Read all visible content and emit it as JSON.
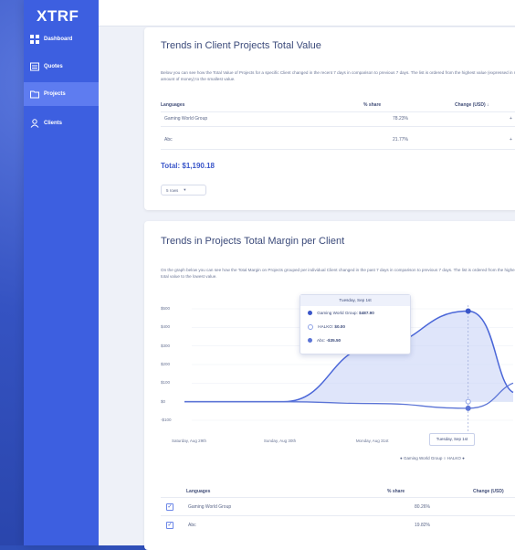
{
  "app": {
    "logo": "XTRF"
  },
  "sidebar": {
    "items": [
      {
        "label": "Dashboard",
        "icon": "dashboard-icon"
      },
      {
        "label": "Quotes",
        "icon": "quotes-icon"
      },
      {
        "label": "Projects",
        "icon": "projects-icon",
        "active": true
      },
      {
        "label": "Clients",
        "icon": "clients-icon"
      }
    ]
  },
  "card1": {
    "title": "Trends in Client Projects Total Value",
    "description": "Below you can see how the Total Value of Projects for a specific Client changed in the recent 7 days in comparison to previous 7 days. The list is ordered from the highest value (expressed in real amount of money) to the smallest value.",
    "headers": {
      "languages": "Languages",
      "share": "% share",
      "change": "Change (USD)"
    },
    "rows": [
      {
        "name": "Gaming World Group",
        "share": "78.23%",
        "change": "+"
      },
      {
        "name": "Abc",
        "share": "21.77%",
        "change": "+"
      }
    ],
    "total": "Total: $1,190.18",
    "select_label": "5 rows"
  },
  "card2": {
    "title": "Trends in Projects Total Margin per Client",
    "description": "On the graph below you can see how the Total Margin on Projects grouped per individual Client changed in the past 7 days in comparison to previous 7 days. The list is ordered from the highest total value to the lowest value.",
    "headers": {
      "languages": "Languages",
      "share": "% share",
      "change": "Change (USD)"
    },
    "rows": [
      {
        "name": "Gaming World Group",
        "share": "80.26%"
      },
      {
        "name": "Abc",
        "share": "19.82%"
      }
    ]
  },
  "tooltip": {
    "date": "Tuesday, Sep 1st",
    "entries": [
      {
        "name": "Gaming World Group",
        "value": "$487.90"
      },
      {
        "name": "HALKO",
        "value": "$0.00"
      },
      {
        "name": "Abc",
        "value": "-$35.50"
      }
    ]
  },
  "chart_data": {
    "type": "area",
    "x": [
      "Saturday, Aug 29th",
      "Sunday, Aug 30th",
      "Monday, Aug 31st",
      "Tuesday, Sep 1st"
    ],
    "y_ticks": [
      "$500",
      "$400",
      "$300",
      "$200",
      "$100",
      "$0",
      "-$100"
    ],
    "ylim": [
      -100,
      500
    ],
    "series": [
      {
        "name": "Gaming World Group",
        "values": [
          0,
          0,
          300,
          487.9
        ],
        "color": "#3a56c9"
      },
      {
        "name": "HALKO",
        "values": [
          0,
          0,
          0,
          0
        ],
        "color": "#8fa3e6"
      },
      {
        "name": "Abc",
        "values": [
          0,
          0,
          -10,
          -35.5
        ],
        "color": "#5b74d6"
      }
    ],
    "highlighted_x": "Tuesday, Sep 1st",
    "legend": [
      "Gaming World Group",
      "HALKO",
      "Abc"
    ]
  }
}
